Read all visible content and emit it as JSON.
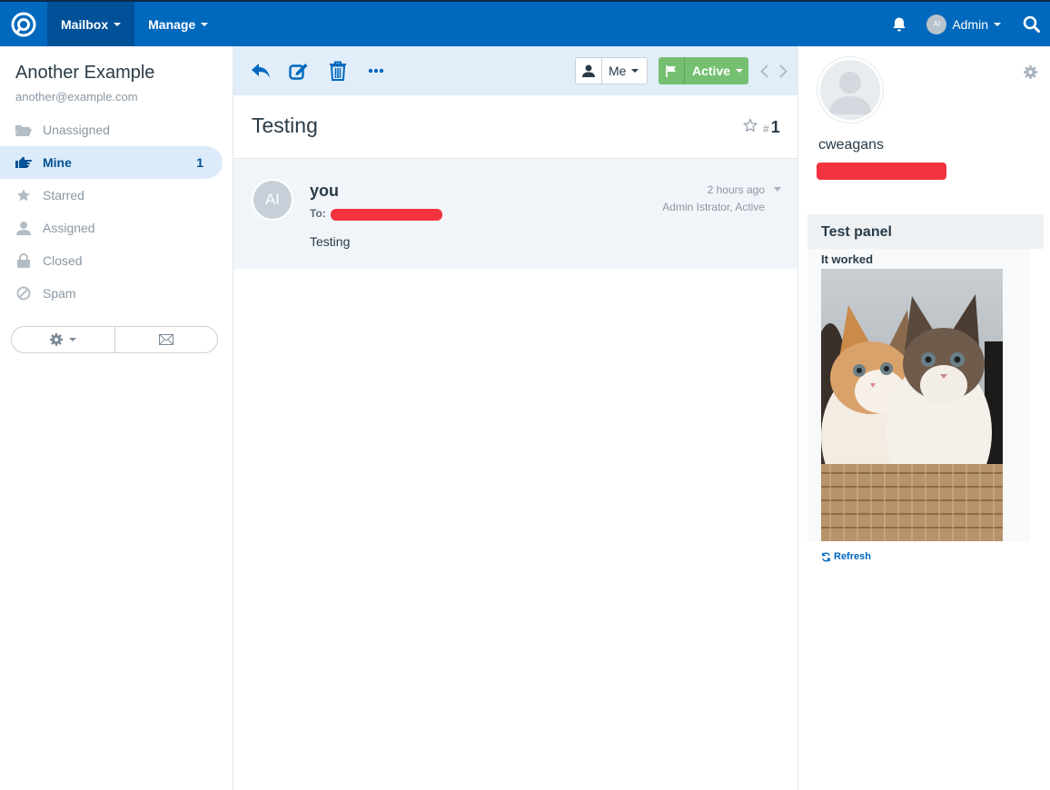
{
  "colors": {
    "brand": "#0068bd",
    "nav_active": "#005198",
    "status_active": "#75bf70",
    "redaction": "#f2333f"
  },
  "nav": {
    "logo_icon": "freescout-logo-icon",
    "mailbox_label": "Mailbox",
    "manage_label": "Manage",
    "user_initials": "AI",
    "user_label": "Admin"
  },
  "sidebar": {
    "mailbox_name": "Another Example",
    "mailbox_email": "another@example.com",
    "folders": [
      {
        "label": "Unassigned",
        "icon": "folder-open-icon",
        "count": ""
      },
      {
        "label": "Mine",
        "icon": "hand-pointer-icon",
        "count": "1"
      },
      {
        "label": "Starred",
        "icon": "star-icon",
        "count": ""
      },
      {
        "label": "Assigned",
        "icon": "user-icon",
        "count": ""
      },
      {
        "label": "Closed",
        "icon": "lock-icon",
        "count": ""
      },
      {
        "label": "Spam",
        "icon": "ban-icon",
        "count": ""
      }
    ]
  },
  "toolbar": {
    "assignee_label": "Me",
    "status_label": "Active"
  },
  "conversation": {
    "subject": "Testing",
    "hash": "#",
    "number": "1",
    "thread": {
      "avatar_initials": "AI",
      "from": "you",
      "to_label": "To:",
      "time": "2 hours ago",
      "meta": "Admin Istrator, Active",
      "body": "Testing"
    }
  },
  "customer": {
    "name": "cweagans"
  },
  "panel": {
    "title": "Test panel",
    "body_text": "It worked",
    "refresh_label": "Refresh"
  }
}
